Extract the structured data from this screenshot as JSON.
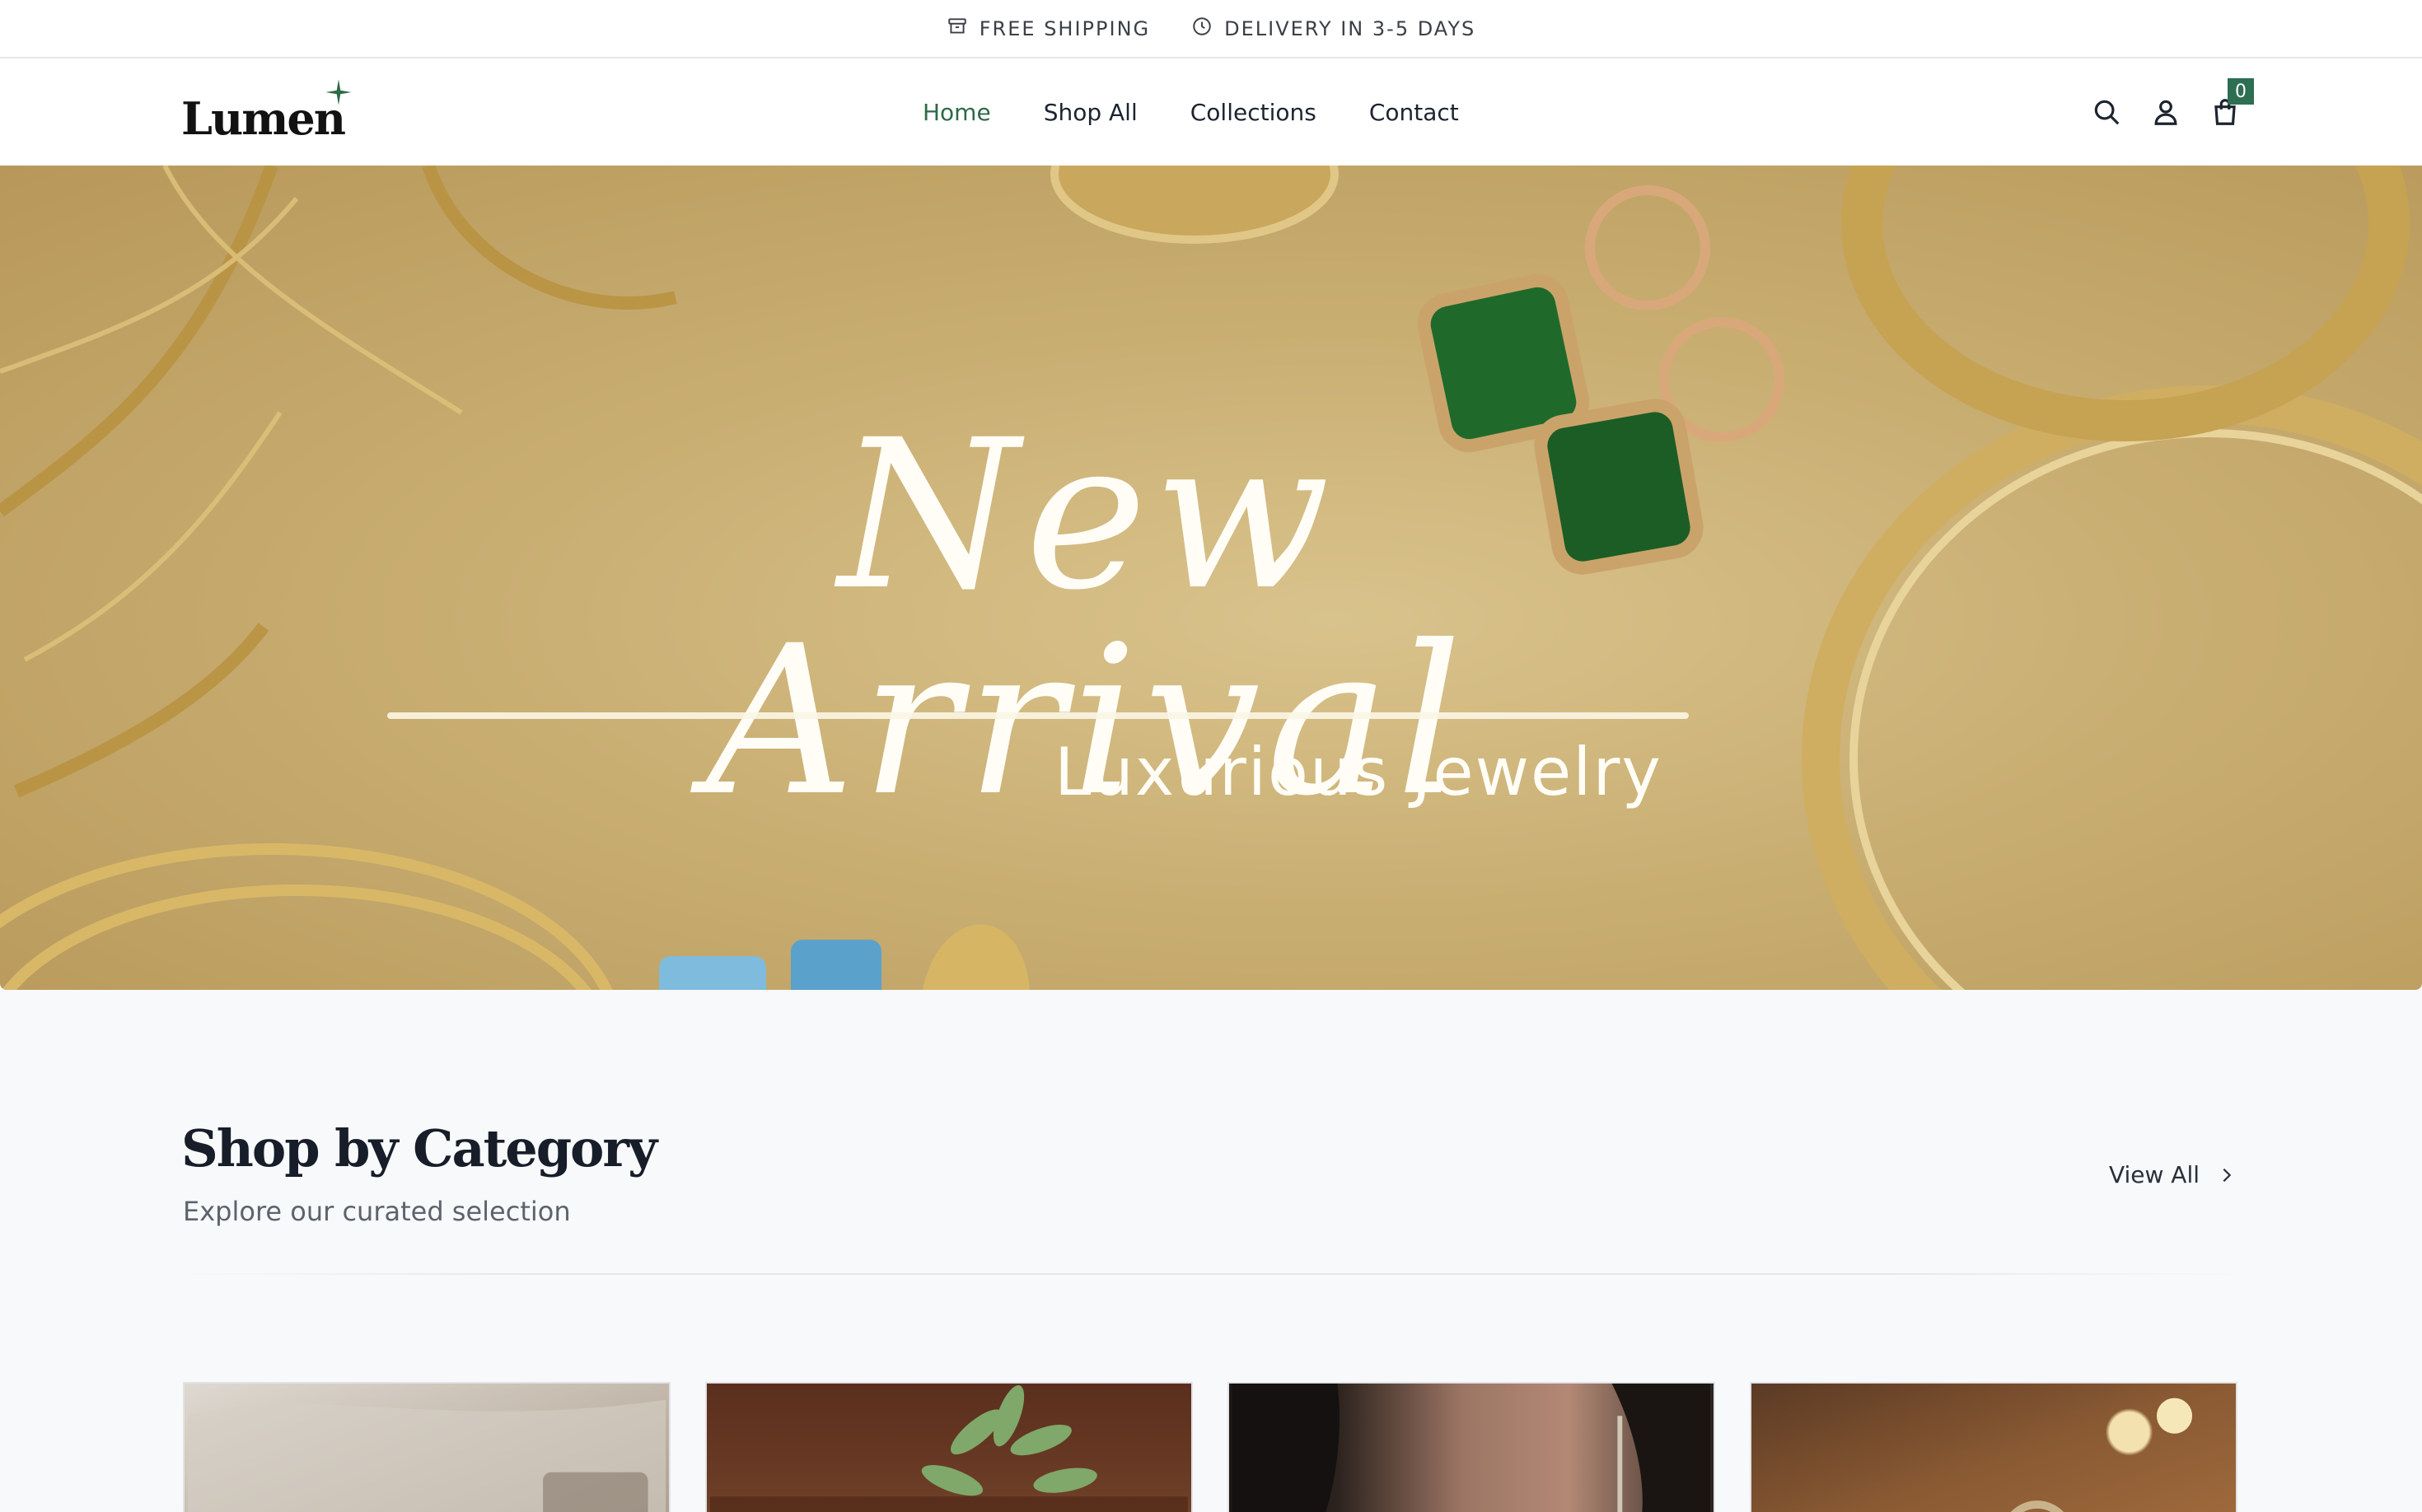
{
  "announcement": {
    "items": [
      {
        "icon": "box-icon",
        "label": "FREE SHIPPING"
      },
      {
        "icon": "clock-icon",
        "label": "DELIVERY IN 3-5 DAYS"
      }
    ]
  },
  "header": {
    "logo": "Lumen",
    "nav": [
      {
        "label": "Home",
        "active": true
      },
      {
        "label": "Shop All",
        "active": false
      },
      {
        "label": "Collections",
        "active": false
      },
      {
        "label": "Contact",
        "active": false
      }
    ],
    "cart_count": "0"
  },
  "hero": {
    "title": "New Arrival",
    "subtitle": "Luxurious Jewelry"
  },
  "category_section": {
    "title": "Shop by Category",
    "subtitle": "Explore our curated selection",
    "view_all": "View All"
  },
  "colors": {
    "accent": "#2d6a48",
    "badge": "#2e6e52",
    "hero_gold": "#c9ae72",
    "page_bg": "#f8f9fb"
  }
}
